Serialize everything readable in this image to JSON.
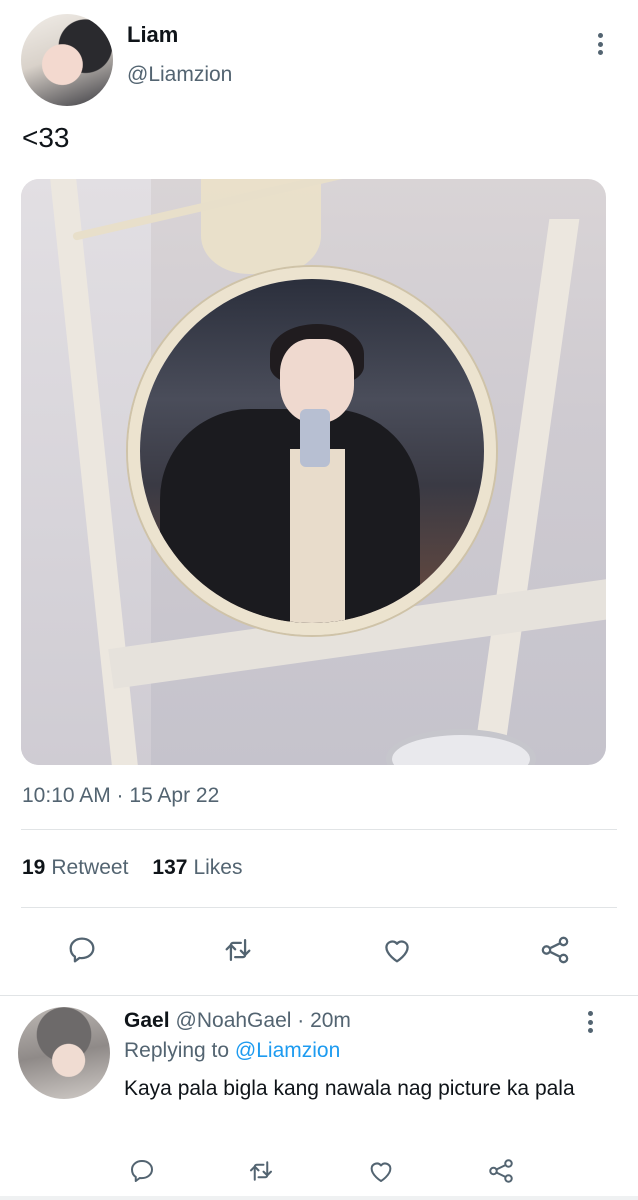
{
  "tweet": {
    "author": {
      "name": "Liam",
      "handle": "@Liamzion"
    },
    "text": "<33",
    "timestamp": "10:10 AM · 15 Apr 22",
    "stats": {
      "retweets": "19",
      "retweets_label": "Retweet",
      "likes": "137",
      "likes_label": "Likes"
    }
  },
  "reply": {
    "name": "Gael",
    "handle_time": "@NoahGael · 20m",
    "replying_prefix": "Replying to",
    "replying_to": "@Liamzion",
    "text": "Kaya pala bigla kang nawala nag picture ka pala"
  },
  "icons": {
    "reply": "reply-icon",
    "retweet": "retweet-icon",
    "like": "heart-icon",
    "share": "share-icon",
    "more": "more-vertical-icon"
  },
  "colors": {
    "text_primary": "#0f1419",
    "text_secondary": "#536471",
    "link": "#1d9bf0",
    "divider": "#e1e4e6"
  }
}
